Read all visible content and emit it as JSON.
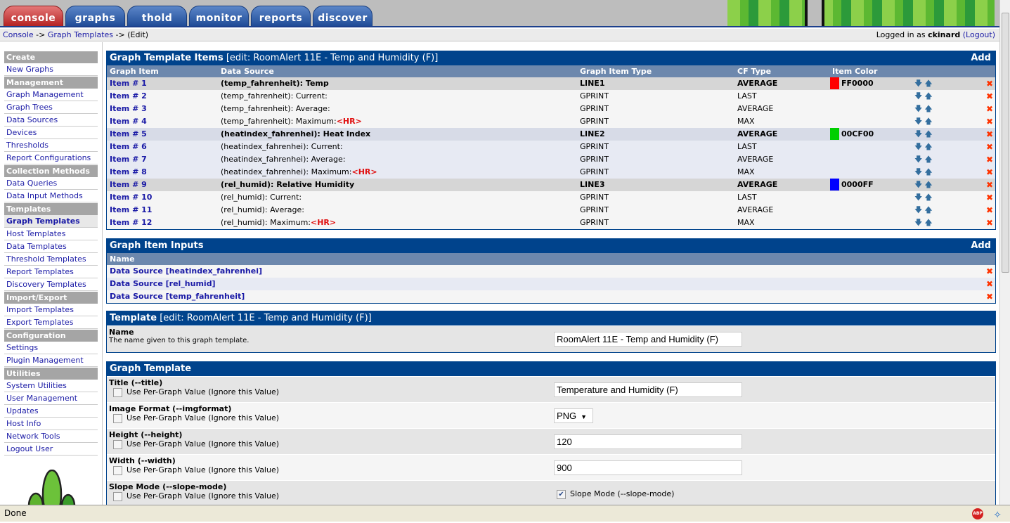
{
  "tabs": [
    {
      "label": "console",
      "active": true
    },
    {
      "label": "graphs"
    },
    {
      "label": "thold"
    },
    {
      "label": "monitor"
    },
    {
      "label": "reports"
    },
    {
      "label": "discover"
    }
  ],
  "breadcrumb": {
    "console": "Console",
    "sep": "->",
    "graph_templates": "Graph Templates",
    "edit": "(Edit)"
  },
  "login": {
    "prefix": "Logged in as",
    "user": "ckinard",
    "logout": "(Logout)"
  },
  "sidebar": [
    {
      "header": "Create",
      "items": [
        "New Graphs"
      ]
    },
    {
      "header": "Management",
      "items": [
        "Graph Management",
        "Graph Trees",
        "Data Sources",
        "Devices",
        "Thresholds",
        "Report Configurations"
      ]
    },
    {
      "header": "Collection Methods",
      "items": [
        "Data Queries",
        "Data Input Methods"
      ]
    },
    {
      "header": "Templates",
      "items": [
        "Graph Templates",
        "Host Templates",
        "Data Templates",
        "Threshold Templates",
        "Report Templates",
        "Discovery Templates"
      ]
    },
    {
      "header": "Import/Export",
      "items": [
        "Import Templates",
        "Export Templates"
      ]
    },
    {
      "header": "Configuration",
      "items": [
        "Settings",
        "Plugin Management"
      ]
    },
    {
      "header": "Utilities",
      "items": [
        "System Utilities",
        "User Management",
        "Updates",
        "Host Info",
        "Network Tools",
        "Logout User"
      ]
    }
  ],
  "sidebar_selected": "Graph Templates",
  "items_box": {
    "title": "Graph Template Items",
    "edit": "[edit: RoomAlert 11E - Temp and Humidity (F)]",
    "add": "Add",
    "columns": [
      "Graph Item",
      "Data Source",
      "Graph Item Type",
      "CF Type",
      "Item Color"
    ],
    "rows": [
      {
        "item": "Item # 1",
        "source": "(temp_fahrenheit): Temp",
        "hr": "",
        "type": "LINE1",
        "cf": "AVERAGE",
        "color": "FF0000",
        "bold": true,
        "group": 1
      },
      {
        "item": "Item # 2",
        "source": "(temp_fahrenheit): Current:",
        "hr": "",
        "type": "GPRINT",
        "cf": "LAST",
        "color": "",
        "group": 1
      },
      {
        "item": "Item # 3",
        "source": "(temp_fahrenheit): Average:",
        "hr": "",
        "type": "GPRINT",
        "cf": "AVERAGE",
        "color": "",
        "group": 1
      },
      {
        "item": "Item # 4",
        "source": "(temp_fahrenheit): Maximum:",
        "hr": "<HR>",
        "type": "GPRINT",
        "cf": "MAX",
        "color": "",
        "group": 1
      },
      {
        "item": "Item # 5",
        "source": "(heatindex_fahrenhei): Heat Index",
        "hr": "",
        "type": "LINE2",
        "cf": "AVERAGE",
        "color": "00CF00",
        "bold": true,
        "group": 2
      },
      {
        "item": "Item # 6",
        "source": "(heatindex_fahrenhei): Current:",
        "hr": "",
        "type": "GPRINT",
        "cf": "LAST",
        "color": "",
        "group": 2
      },
      {
        "item": "Item # 7",
        "source": "(heatindex_fahrenhei): Average:",
        "hr": "",
        "type": "GPRINT",
        "cf": "AVERAGE",
        "color": "",
        "group": 2
      },
      {
        "item": "Item # 8",
        "source": "(heatindex_fahrenhei): Maximum:",
        "hr": "<HR>",
        "type": "GPRINT",
        "cf": "MAX",
        "color": "",
        "group": 2
      },
      {
        "item": "Item # 9",
        "source": "(rel_humid): Relative Humidity",
        "hr": "",
        "type": "LINE3",
        "cf": "AVERAGE",
        "color": "0000FF",
        "bold": true,
        "group": 1
      },
      {
        "item": "Item # 10",
        "source": "(rel_humid): Current:",
        "hr": "",
        "type": "GPRINT",
        "cf": "LAST",
        "color": "",
        "group": 1
      },
      {
        "item": "Item # 11",
        "source": "(rel_humid): Average:",
        "hr": "",
        "type": "GPRINT",
        "cf": "AVERAGE",
        "color": "",
        "group": 1
      },
      {
        "item": "Item # 12",
        "source": "(rel_humid): Maximum:",
        "hr": "<HR>",
        "type": "GPRINT",
        "cf": "MAX",
        "color": "",
        "group": 1
      }
    ]
  },
  "inputs_box": {
    "title": "Graph Item Inputs",
    "add": "Add",
    "column": "Name",
    "rows": [
      "Data Source [heatindex_fahrenhei]",
      "Data Source [rel_humid]",
      "Data Source [temp_fahrenheit]"
    ]
  },
  "template_box": {
    "title": "Template",
    "edit": "[edit: RoomAlert 11E - Temp and Humidity (F)]",
    "name_label": "Name",
    "name_desc": "The name given to this graph template.",
    "name_value": "RoomAlert 11E - Temp and Humidity (F)"
  },
  "graph_template_box": {
    "title": "Graph Template",
    "per_graph": "Use Per-Graph Value (Ignore this Value)",
    "fields": [
      {
        "label": "Title (--title)",
        "kind": "text",
        "value": "Temperature and Humidity (F)"
      },
      {
        "label": "Image Format (--imgformat)",
        "kind": "select",
        "value": "PNG"
      },
      {
        "label": "Height (--height)",
        "kind": "text",
        "value": "120"
      },
      {
        "label": "Width (--width)",
        "kind": "text",
        "value": "900"
      },
      {
        "label": "Slope Mode (--slope-mode)",
        "kind": "checkbox",
        "value": "Slope Mode (--slope-mode)",
        "checked": true
      }
    ]
  },
  "status": {
    "text": "Done",
    "abp": "ABP"
  }
}
